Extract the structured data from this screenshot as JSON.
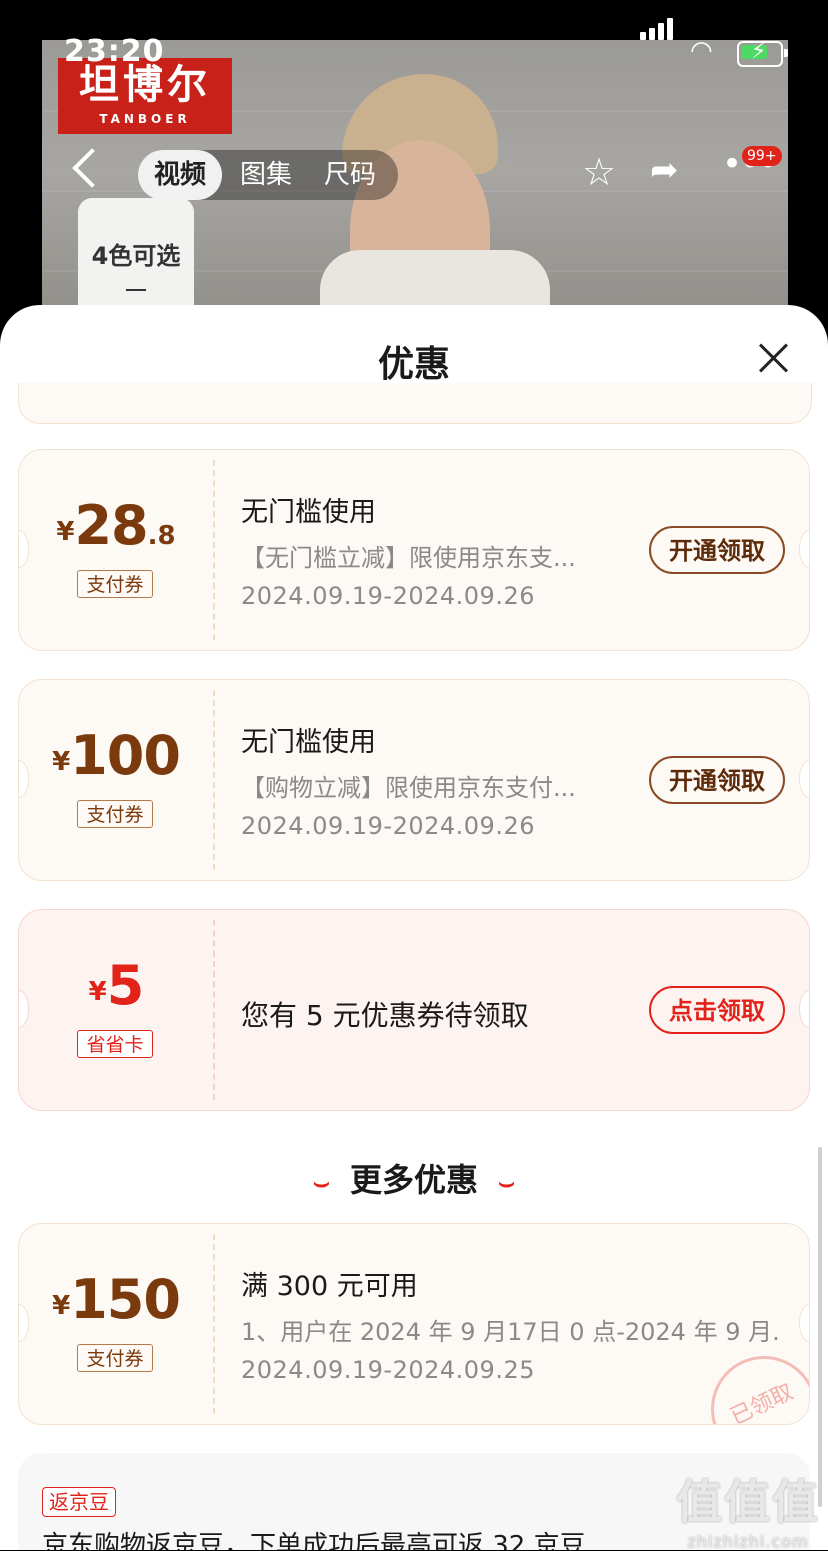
{
  "status_bar": {
    "time": "23:20"
  },
  "brand": {
    "name_cn": "坦博尔",
    "name_en": "TANBOER"
  },
  "top_nav": {
    "tabs": [
      {
        "label": "视频",
        "active": true
      },
      {
        "label": "图集",
        "active": false
      },
      {
        "label": "尺码",
        "active": false
      }
    ],
    "more_badge": "99+"
  },
  "color_selector": {
    "label": "4色可选"
  },
  "sheet": {
    "title": "优惠"
  },
  "coupons": [
    {
      "currency": "¥",
      "amount": "28",
      "decimal": ".8",
      "tag": "支付券",
      "title": "无门槛使用",
      "desc": "【无门槛立减】限使用京东支...",
      "date": "2024.09.19-2024.09.26",
      "button": "开通领取"
    },
    {
      "currency": "¥",
      "amount": "100",
      "decimal": "",
      "tag": "支付券",
      "title": "无门槛使用",
      "desc": "【购物立减】限使用京东支付...",
      "date": "2024.09.19-2024.09.26",
      "button": "开通领取"
    },
    {
      "currency": "¥",
      "amount": "5",
      "decimal": "",
      "tag": "省省卡",
      "title": "您有 5 元优惠券待领取",
      "button": "点击领取"
    }
  ],
  "more_section": {
    "title": "更多优惠"
  },
  "more_coupon": {
    "currency": "¥",
    "amount": "150",
    "tag": "支付券",
    "title": "满 300 元可用",
    "desc": "1、用户在 2024 年 9 月17日 0 点-2024 年 9 月...",
    "date": "2024.09.19-2024.09.25",
    "stamp": "已领取"
  },
  "bean": {
    "tag": "返京豆",
    "text": "京东购物返京豆，下单成功后最高可返 32 京豆"
  },
  "watermark": {
    "big": "值值值",
    "small": "zhizhizhi.com"
  },
  "colors": {
    "accent_red": "#e2231a",
    "coupon_brown": "#7a3a0d",
    "card_bg": "#fdf9f4"
  }
}
